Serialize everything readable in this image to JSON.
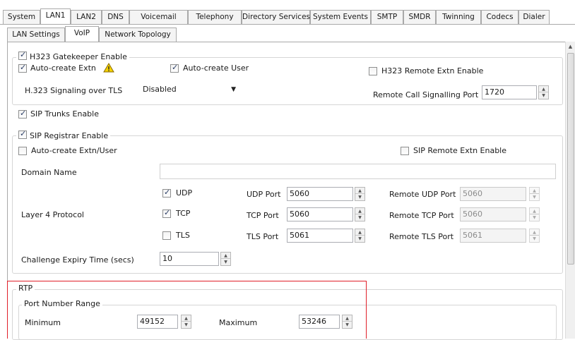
{
  "tabs": {
    "main": [
      "System",
      "LAN1",
      "LAN2",
      "DNS",
      "Voicemail",
      "Telephony",
      "Directory Services",
      "System Events",
      "SMTP",
      "SMDR",
      "Twinning",
      "Codecs",
      "Dialer"
    ],
    "sub": [
      "LAN Settings",
      "VoIP",
      "Network Topology"
    ]
  },
  "h323": {
    "legend": "H323 Gatekeeper Enable",
    "auto_create_extn": "Auto-create Extn",
    "auto_create_user": "Auto-create User",
    "remote_extn": "H323 Remote Extn Enable",
    "signaling_tls_label": "H.323 Signaling over TLS",
    "signaling_tls_value": "Disabled",
    "remote_port_label": "Remote Call Signalling Port",
    "remote_port_value": "1720"
  },
  "sip_trunks": {
    "label": "SIP Trunks Enable"
  },
  "sip_registrar": {
    "legend": "SIP Registrar Enable",
    "auto_create": "Auto-create Extn/User",
    "remote_extn": "SIP Remote Extn Enable",
    "domain_label": "Domain Name",
    "domain_value": "",
    "layer4_label": "Layer 4 Protocol",
    "udp": "UDP",
    "tcp": "TCP",
    "tls": "TLS",
    "udp_port_label": "UDP Port",
    "udp_port": "5060",
    "tcp_port_label": "TCP Port",
    "tcp_port": "5060",
    "tls_port_label": "TLS Port",
    "tls_port": "5061",
    "remote_udp_label": "Remote UDP Port",
    "remote_udp": "5060",
    "remote_tcp_label": "Remote TCP Port",
    "remote_tcp": "5060",
    "remote_tls_label": "Remote TLS Port",
    "remote_tls": "5061",
    "challenge_label": "Challenge Expiry Time (secs)",
    "challenge_value": "10"
  },
  "rtp": {
    "legend": "RTP",
    "range_legend": "Port Number Range",
    "min_label": "Minimum",
    "min_value": "49152",
    "max_label": "Maximum",
    "max_value": "53246"
  },
  "colors": {
    "highlight": "#e0202a",
    "warning": "#f5d200"
  }
}
